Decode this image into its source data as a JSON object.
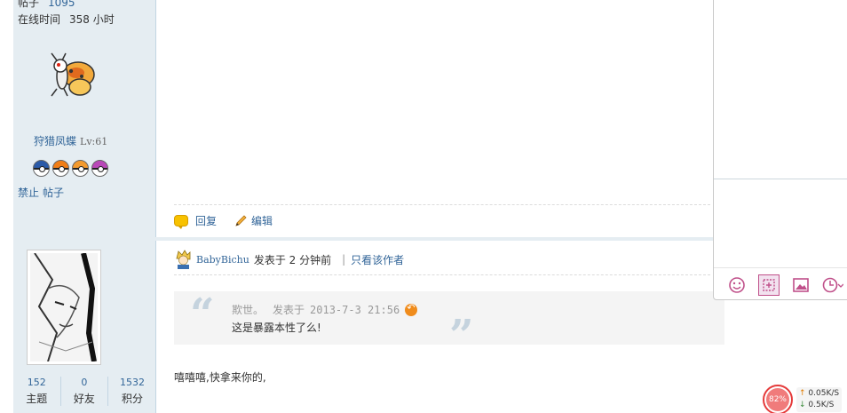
{
  "profile": {
    "posts_label": "帖子",
    "posts_value": "1095",
    "online_label": "在线时间",
    "online_value": "358 小时",
    "pet_name": "狩猎凤蝶",
    "pet_level": "Lv:61",
    "ban_label": "禁止",
    "ban_posts_label": "帖子"
  },
  "actions": {
    "reply": "回复",
    "edit": "编辑"
  },
  "post": {
    "author": "BabyBichu",
    "posted_at": "发表于 2 分钟前",
    "only_author": "只看该作者",
    "quote": {
      "author": "欺世。",
      "posted": "发表于",
      "timestamp": "2013-7-3 21:56",
      "text": "这是暴露本性了么!"
    },
    "body": "嘻嘻嘻,快拿来你的,"
  },
  "user_stats": {
    "threads_value": "152",
    "threads_label": "主题",
    "friends_value": "0",
    "friends_label": "好友",
    "points_value": "1532",
    "points_label": "积分"
  },
  "speed": {
    "percent": "82%",
    "upload": "0.05K/S",
    "download": "0.5K/S"
  },
  "editor_tools": [
    "emoticon-icon",
    "screenshot-icon",
    "image-icon",
    "clock-icon"
  ],
  "colors": {
    "sidebar_bg": "#e5edf2",
    "link": "#336699",
    "quote_bg": "#f4f4f4"
  }
}
